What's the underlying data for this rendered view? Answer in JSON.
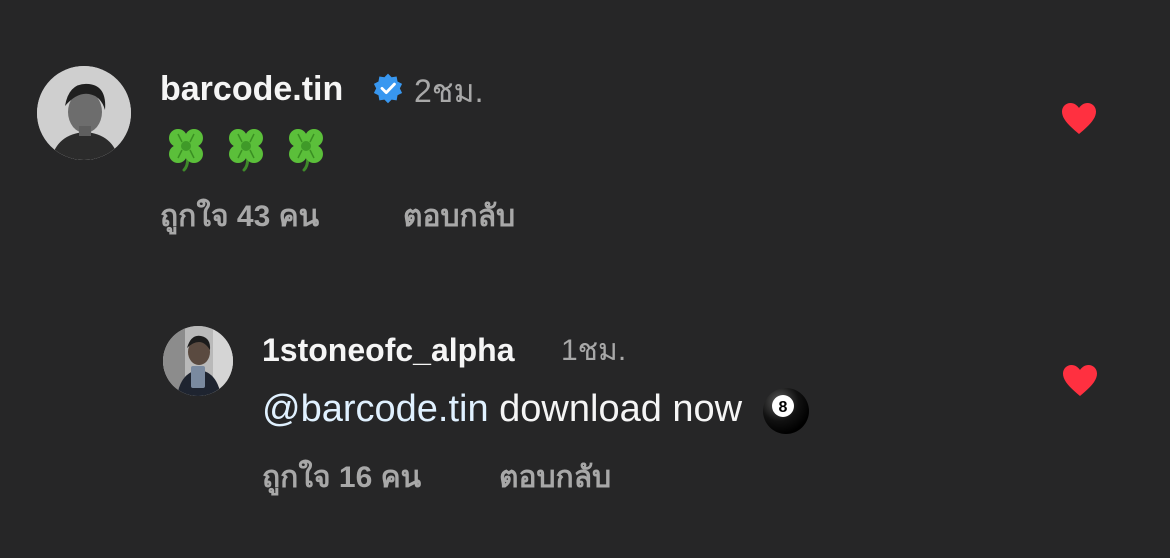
{
  "comments": [
    {
      "username": "barcode.tin",
      "verified": true,
      "time": "2ชม.",
      "emojis": [
        "four-leaf-clover",
        "four-leaf-clover",
        "four-leaf-clover"
      ],
      "likes_label": "ถูกใจ 43 คน",
      "reply_label": "ตอบกลับ",
      "liked": true
    },
    {
      "username": "1stoneofc_alpha",
      "verified": false,
      "time": "1ชม.",
      "mention": "@barcode.tin",
      "text": "download now",
      "emoji": "pool-8-ball",
      "likes_label": "ถูกใจ 16 คน",
      "reply_label": "ตอบกลับ",
      "liked": true
    }
  ],
  "colors": {
    "background": "#262627",
    "primary_text": "#f5f5f5",
    "secondary_text": "#a8a8a8",
    "heart": "#ff3040",
    "verified": "#3897f0",
    "mention": "#e0f1ff"
  }
}
